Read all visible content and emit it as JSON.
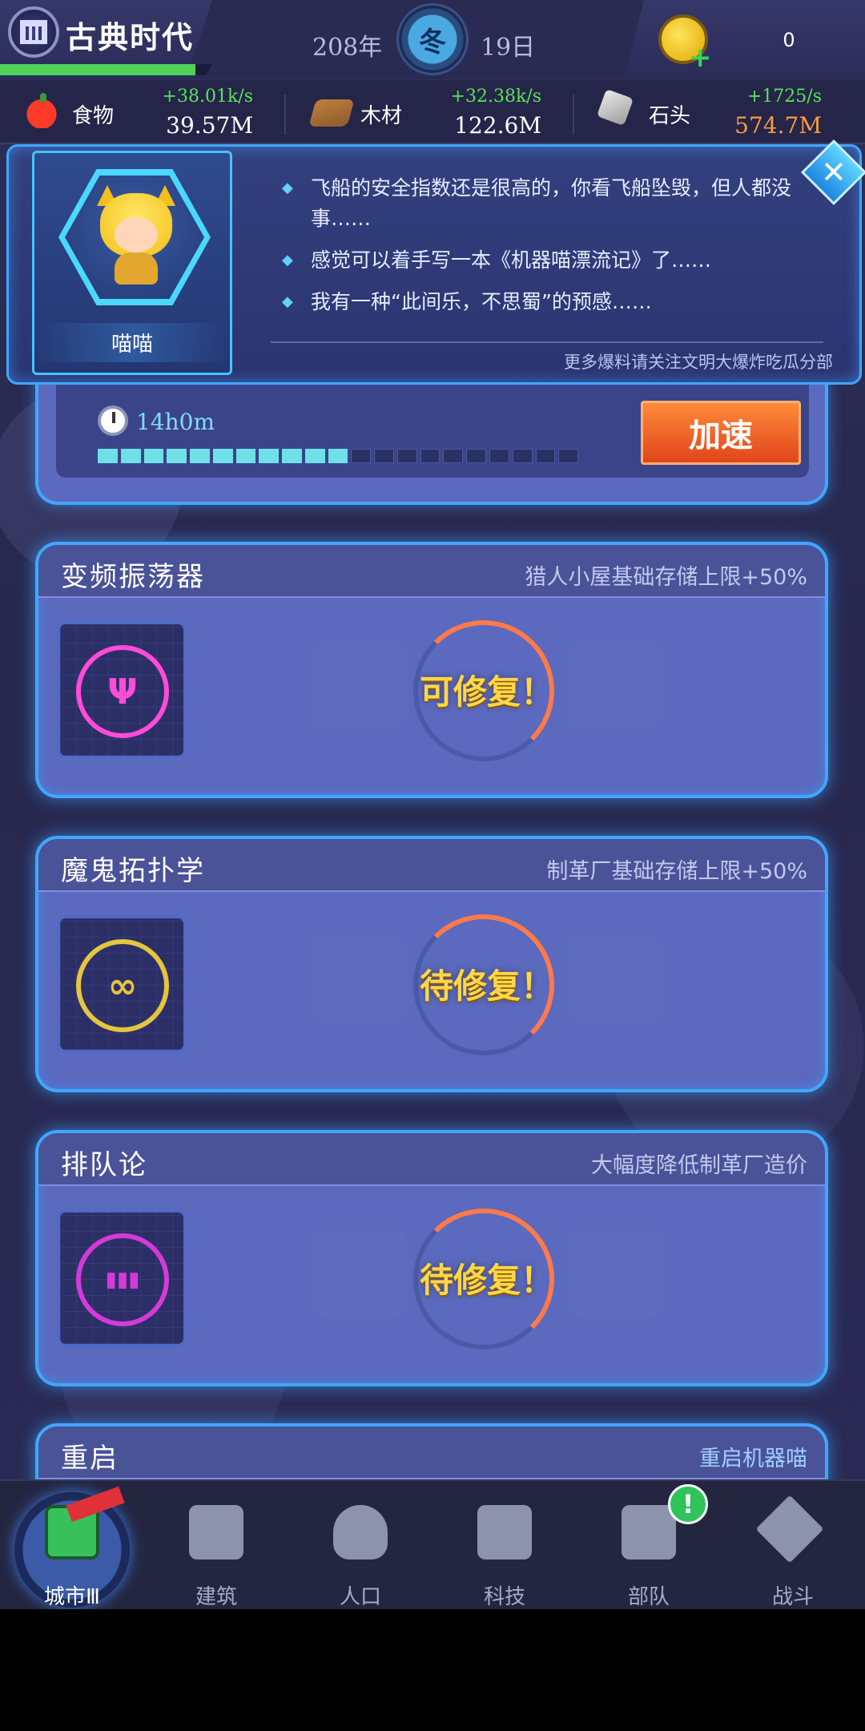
{
  "header": {
    "era_name": "古典时代",
    "era_progress": 0.92,
    "year": "208年",
    "season": "冬",
    "day": "19日",
    "coins": "0"
  },
  "resources": [
    {
      "name": "食物",
      "rate": "+38.01k/s",
      "amount": "39.57M",
      "icon": "apple-icon"
    },
    {
      "name": "木材",
      "rate": "+32.38k/s",
      "amount": "122.6M",
      "icon": "wood-log-icon"
    },
    {
      "name": "石头",
      "rate": "+1725/s",
      "amount": "574.7M",
      "icon": "stone-icon",
      "amount_color": "#ff9a40"
    }
  ],
  "dialog": {
    "character_name": "喵喵",
    "messages": [
      "飞船的安全指数还是很高的，你看飞船坠毁，但人都没事……",
      "感觉可以着手写一本《机器喵漂流记》了……",
      "我有一种“此间乐，不思蜀”的预感……"
    ],
    "footer": "更多爆料请关注文明大爆炸吃瓜分部",
    "close_label": "✕"
  },
  "progress": {
    "timer": "14h0m",
    "filled_segments": 11,
    "total_segments": 21,
    "speed_label": "加速"
  },
  "techs": [
    {
      "title": "变频振荡器",
      "desc": "猎人小屋基础存储上限+50%",
      "status": "可修复！",
      "icon": "tuning-fork-icon",
      "glyph": "Ψ"
    },
    {
      "title": "魔鬼拓扑学",
      "desc": "制革厂基础存储上限+50%",
      "status": "待修复！",
      "icon": "infinity-icon",
      "glyph": "∞"
    },
    {
      "title": "排队论",
      "desc": "大幅度降低制革厂造价",
      "status": "待修复！",
      "icon": "queue-icon",
      "glyph": "▮▮▮"
    }
  ],
  "partial_tech": {
    "title": "重启",
    "desc": "重启机器喵"
  },
  "nav": [
    {
      "label": "城市Ⅲ",
      "icon": "castle-icon",
      "active": true
    },
    {
      "label": "建筑",
      "icon": "house-icon"
    },
    {
      "label": "人口",
      "icon": "person-icon"
    },
    {
      "label": "科技",
      "icon": "book-icon"
    },
    {
      "label": "部队",
      "icon": "banner-icon",
      "badge": "!"
    },
    {
      "label": "战斗",
      "icon": "crossed-swords-icon"
    }
  ]
}
